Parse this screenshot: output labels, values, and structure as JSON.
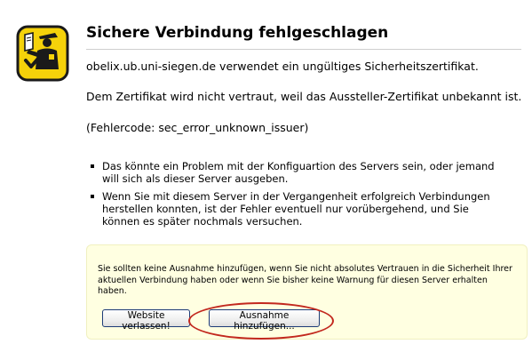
{
  "error": {
    "title": "Sichere Verbindung fehlgeschlagen",
    "host_message": "obelix.ub.uni-siegen.de verwendet ein ungültiges Sicherheitszertifikat.",
    "trust_message": "Dem Zertifikat wird nicht vertraut, weil das Aussteller-Zertifikat unbekannt ist.",
    "error_code": "(Fehlercode: sec_error_unknown_issuer)"
  },
  "bullets": [
    {
      "text": "Das könnte ein Problem mit der Konfiguartion des Servers sein, oder jemand\nwill sich als dieser Server ausgeben."
    },
    {
      "text": "Wenn Sie mit diesem Server in der Vergangenheit erfolgreich Verbindungen\nherstellen konnten, ist der Fehler eventuell nur vorübergehend, und Sie\nkönnen es später nochmals versuchen."
    }
  ],
  "warning": {
    "text": "Sie sollten keine Ausnahme hinzufügen, wenn Sie nicht absolutes Vertrauen in die Sicherheit Ihrer\naktuellen Verbindung haben oder wenn Sie bisher keine Warnung für diesen Server erhalten\nhaben."
  },
  "buttons": {
    "leave_label": "Website verlassen!",
    "exception_label": "Ausnahme hinzufügen..."
  },
  "icon": {
    "name": "security-officer-icon",
    "background_color": "#f5d20a",
    "outline_color": "#1a1a1a"
  },
  "annotation": {
    "color": "#c2281e"
  }
}
